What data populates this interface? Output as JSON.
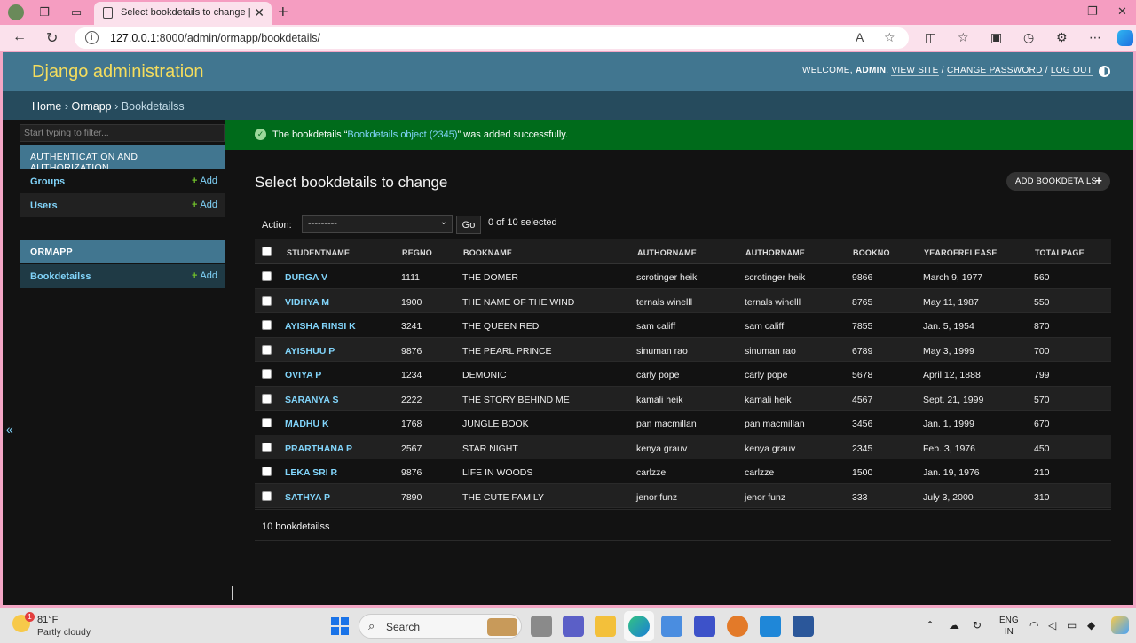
{
  "browser": {
    "tab_title": "Select bookdetails to change | Dj",
    "url_host": "127.0.0.1",
    "url_rest": ":8000/admin/ormapp/bookdetails/"
  },
  "header": {
    "brand": "Django administration",
    "welcome": "WELCOME,",
    "username": "ADMIN",
    "view_site": "VIEW SITE",
    "change_password": "CHANGE PASSWORD",
    "log_out": "LOG OUT",
    "sep": "/"
  },
  "breadcrumbs": {
    "home": "Home",
    "app": "Ormapp",
    "model": "Bookdetailss",
    "sep": "›"
  },
  "sidebar": {
    "filter_placeholder": "Start typing to filter...",
    "auth_caption": "AUTHENTICATION AND AUTHORIZATION",
    "groups": "Groups",
    "users": "Users",
    "ormapp_caption": "ORMAPP",
    "bookdetailss": "Bookdetailss",
    "add": "Add",
    "collapse": "«"
  },
  "message": {
    "prefix": "The bookdetails “",
    "object": "Bookdetails object (2345)",
    "suffix": "” was added successfully."
  },
  "content": {
    "title": "Select bookdetails to change",
    "add_button": "ADD BOOKDETAILS"
  },
  "actions": {
    "label": "Action:",
    "selected": "---------",
    "go": "Go",
    "count": "0 of 10 selected"
  },
  "table": {
    "headers": [
      "STUDENTNAME",
      "REGNO",
      "BOOKNAME",
      "AUTHORNAME",
      "AUTHORNAME",
      "BOOKNO",
      "YEAROFRELEASE",
      "TOTALPAGE"
    ],
    "rows": [
      [
        "DURGA V",
        "1111",
        "THE DOMER",
        "scrotinger heik",
        "scrotinger heik",
        "9866",
        "March 9, 1977",
        "560"
      ],
      [
        "VIDHYA M",
        "1900",
        "THE NAME OF THE WIND",
        "ternals winelll",
        "ternals winelll",
        "8765",
        "May 11, 1987",
        "550"
      ],
      [
        "AYISHA RINSI K",
        "3241",
        "THE QUEEN RED",
        "sam califf",
        "sam califf",
        "7855",
        "Jan. 5, 1954",
        "870"
      ],
      [
        "AYISHUU P",
        "9876",
        "THE PEARL PRINCE",
        "sinuman rao",
        "sinuman rao",
        "6789",
        "May 3, 1999",
        "700"
      ],
      [
        "OVIYA P",
        "1234",
        "DEMONIC",
        "carly pope",
        "carly pope",
        "5678",
        "April 12, 1888",
        "799"
      ],
      [
        "SARANYA S",
        "2222",
        "THE STORY BEHIND ME",
        "kamali heik",
        "kamali heik",
        "4567",
        "Sept. 21, 1999",
        "570"
      ],
      [
        "MADHU K",
        "1768",
        "JUNGLE BOOK",
        "pan macmillan",
        "pan macmillan",
        "3456",
        "Jan. 1, 1999",
        "670"
      ],
      [
        "PRARTHANA P",
        "2567",
        "STAR NIGHT",
        "kenya grauv",
        "kenya grauv",
        "2345",
        "Feb. 3, 1976",
        "450"
      ],
      [
        "LEKA SRI R",
        "9876",
        "LIFE IN WOODS",
        "carlzze",
        "carlzze",
        "1500",
        "Jan. 19, 1976",
        "210"
      ],
      [
        "SATHYA P",
        "7890",
        "THE CUTE FAMILY",
        "jenor funz",
        "jenor funz",
        "333",
        "July 3, 2000",
        "310"
      ]
    ],
    "footer": "10 bookdetailss"
  },
  "taskbar": {
    "temp": "81°F",
    "condition": "Partly cloudy",
    "weather_badge": "1",
    "search": "Search",
    "lang_1": "ENG",
    "lang_2": "IN"
  },
  "colors": {
    "header": "#417690",
    "breadcrumb": "#264b5d",
    "brand": "#f5dd5d",
    "link": "#81d4fa",
    "success": "#006b1b",
    "add_plus": "#70bf2b"
  }
}
